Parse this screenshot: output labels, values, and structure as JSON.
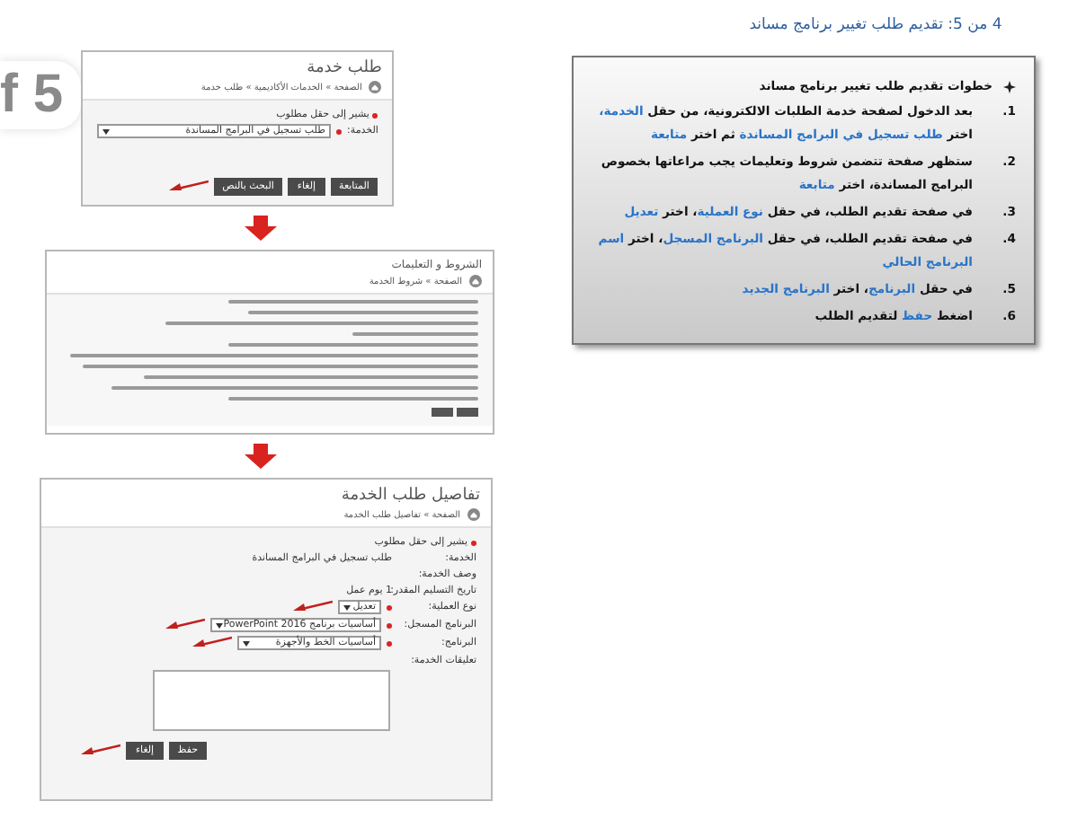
{
  "slide_number": "f 5",
  "screen_1": {
    "title": "طلب خدمة",
    "breadcrumb": "الصفحة » الخدمات الأكاديمية » طلب خدمة",
    "required_note": "يشير إلى حقل مطلوب",
    "service_label": "الخدمة:",
    "service_value": "طلب تسجيل في البرامج المساندة",
    "buttons": [
      "المتابعة",
      "إلغاء",
      "البحث بالنص"
    ]
  },
  "screen_2": {
    "title": "الشروط و التعليمات",
    "breadcrumb": "الصفحة » شروط الخدمة"
  },
  "screen_3": {
    "title": "تفاصيل طلب الخدمة",
    "breadcrumb": "الصفحة » تفاصيل طلب الخدمة",
    "required_note": "يشير إلى حقل مطلوب",
    "fields": [
      {
        "label": "الخدمة:",
        "value": "طلب تسجيل في البرامج المساندة",
        "kind": "text",
        "required": false
      },
      {
        "label": "وصف الخدمة:",
        "kind": "text",
        "required": false
      },
      {
        "label": "تاريخ التسليم المقدر:",
        "value": "1 يوم عمل",
        "kind": "text",
        "required": false
      },
      {
        "label": "نوع العملية:",
        "value": "تعديل",
        "kind": "select",
        "required": true
      },
      {
        "label": "البرنامج المسجل:",
        "value": "أساسيات برنامج PowerPoint 2016",
        "kind": "select",
        "required": true
      },
      {
        "label": "البرنامج:",
        "value": "أساسيات الخط والأجهزة",
        "kind": "select",
        "required": true
      },
      {
        "label": "تعليقات الخدمة:",
        "kind": "textarea",
        "required": false
      }
    ],
    "buttons": [
      "حفظ",
      "إلغاء"
    ]
  },
  "heading": "4 من 5: تقديم طلب تغيير برنامج مساند",
  "steps_box": {
    "title": "خطوات تقديم طلب تغيير برنامج مساند",
    "steps": [
      {
        "number": "1.",
        "parts": [
          {
            "text": "بعد الدخول لصفحة خدمة الطلبات الالكترونية، من حقل ",
            "highlight": false
          },
          {
            "text": "الخدمة،",
            "highlight": true
          },
          {
            "text": " اختر ",
            "highlight": false
          },
          {
            "text": "طلب تسجيل في البرامج المساندة",
            "highlight": true
          },
          {
            "text": " ثم اختر ",
            "highlight": false
          },
          {
            "text": "متابعة",
            "highlight": true
          }
        ]
      },
      {
        "number": "2.",
        "parts": [
          {
            "text": "ستظهر صفحة تتضمن شروط وتعليمات يجب مراعاتها بخصوص البرامج المساندة، اختر ",
            "highlight": false
          },
          {
            "text": "متابعة",
            "highlight": true
          }
        ]
      },
      {
        "number": "3.",
        "parts": [
          {
            "text": "في صفحة تقديم الطلب، في حقل ",
            "highlight": false
          },
          {
            "text": "نوع العملية",
            "highlight": true
          },
          {
            "text": "، اختر ",
            "highlight": false
          },
          {
            "text": "تعديل",
            "highlight": true
          }
        ]
      },
      {
        "number": "4.",
        "parts": [
          {
            "text": "في صفحة تقديم الطلب، في حقل ",
            "highlight": false
          },
          {
            "text": "البرنامج المسجل",
            "highlight": true
          },
          {
            "text": "، اختر ",
            "highlight": false
          },
          {
            "text": "اسم البرنامج الحالي",
            "highlight": true
          }
        ]
      },
      {
        "number": "5.",
        "parts": [
          {
            "text": "في حقل ",
            "highlight": false
          },
          {
            "text": "البرنامج",
            "highlight": true
          },
          {
            "text": "، اختر ",
            "highlight": false
          },
          {
            "text": "البرنامج الجديد",
            "highlight": true
          }
        ]
      },
      {
        "number": "6.",
        "parts": [
          {
            "text": "اضغط ",
            "highlight": false
          },
          {
            "text": "حفظ",
            "highlight": true
          },
          {
            "text": " لتقديم الطلب",
            "highlight": false
          }
        ]
      }
    ]
  }
}
